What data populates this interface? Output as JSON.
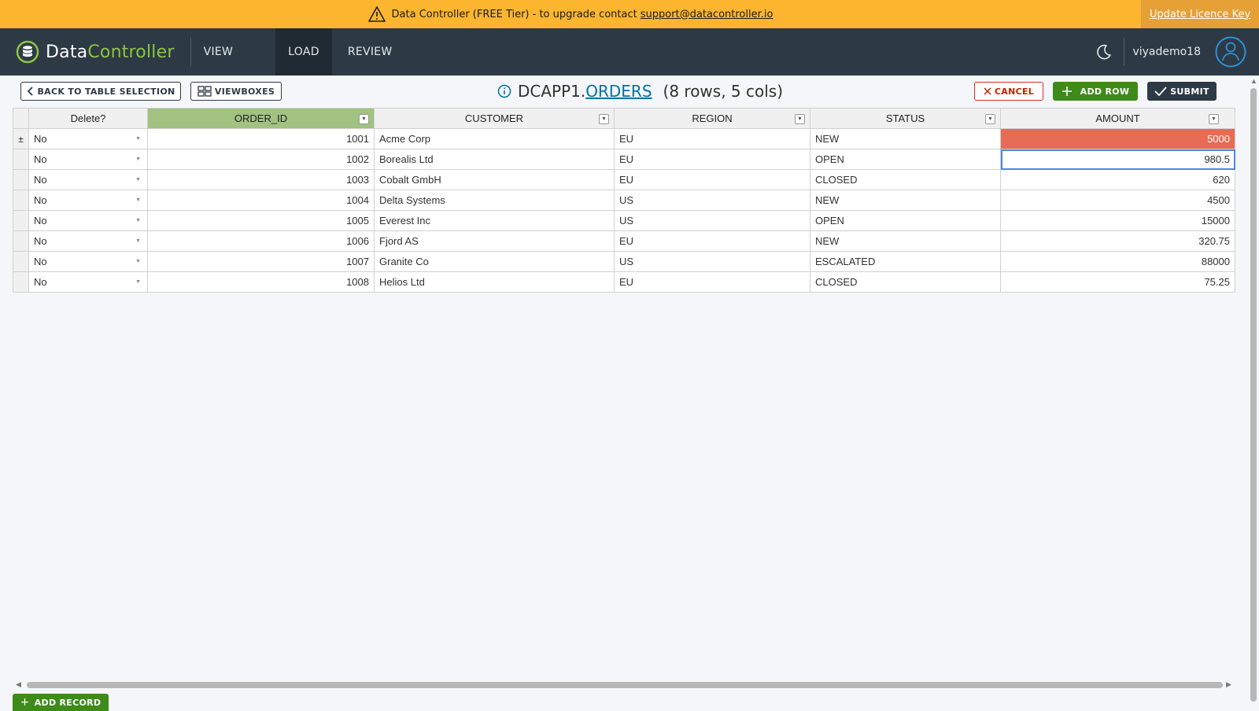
{
  "banner": {
    "message": "Data Controller (FREE Tier) - to upgrade contact",
    "email": "support@datacontroller.io",
    "update_label": "Update Licence Key"
  },
  "header": {
    "logo_a": "Data",
    "logo_b": "Controller",
    "nav": [
      {
        "label": "VIEW"
      },
      {
        "label": "LOAD"
      },
      {
        "label": "REVIEW"
      }
    ],
    "username": "viyademo18"
  },
  "toolbar": {
    "back_label": "BACK TO TABLE SELECTION",
    "viewboxes_label": "VIEWBOXES",
    "library": "DCAPP1.",
    "table": "ORDERS",
    "counts": "(8 rows, 5 cols)",
    "cancel_label": "CANCEL",
    "add_row_label": "ADD ROW",
    "submit_label": "SUBMIT"
  },
  "grid": {
    "columns": [
      "Delete?",
      "ORDER_ID",
      "CUSTOMER",
      "REGION",
      "STATUS",
      "AMOUNT"
    ],
    "row_marker": "±",
    "rows": [
      {
        "del": "No",
        "id": "1001",
        "customer": "Acme Corp",
        "region": "EU",
        "status": "NEW",
        "amount": "5000"
      },
      {
        "del": "No",
        "id": "1002",
        "customer": "Borealis Ltd",
        "region": "EU",
        "status": "OPEN",
        "amount": "980.5"
      },
      {
        "del": "No",
        "id": "1003",
        "customer": "Cobalt GmbH",
        "region": "EU",
        "status": "CLOSED",
        "amount": "620"
      },
      {
        "del": "No",
        "id": "1004",
        "customer": "Delta Systems",
        "region": "US",
        "status": "NEW",
        "amount": "4500"
      },
      {
        "del": "No",
        "id": "1005",
        "customer": "Everest Inc",
        "region": "US",
        "status": "OPEN",
        "amount": "15000"
      },
      {
        "del": "No",
        "id": "1006",
        "customer": "Fjord AS",
        "region": "EU",
        "status": "NEW",
        "amount": "320.75"
      },
      {
        "del": "No",
        "id": "1007",
        "customer": "Granite Co",
        "region": "US",
        "status": "ESCALATED",
        "amount": "88000"
      },
      {
        "del": "No",
        "id": "1008",
        "customer": "Helios Ltd",
        "region": "EU",
        "status": "CLOSED",
        "amount": "75.25"
      }
    ]
  },
  "footer": {
    "add_record_label": "ADD RECORD"
  },
  "colors": {
    "banner": "#fbb52f",
    "header": "#2d3a45",
    "brand_green": "#8cc540",
    "highlight_cell": "#e86b54",
    "selected_header": "#a1c281",
    "button_green": "#3e8b1a"
  }
}
